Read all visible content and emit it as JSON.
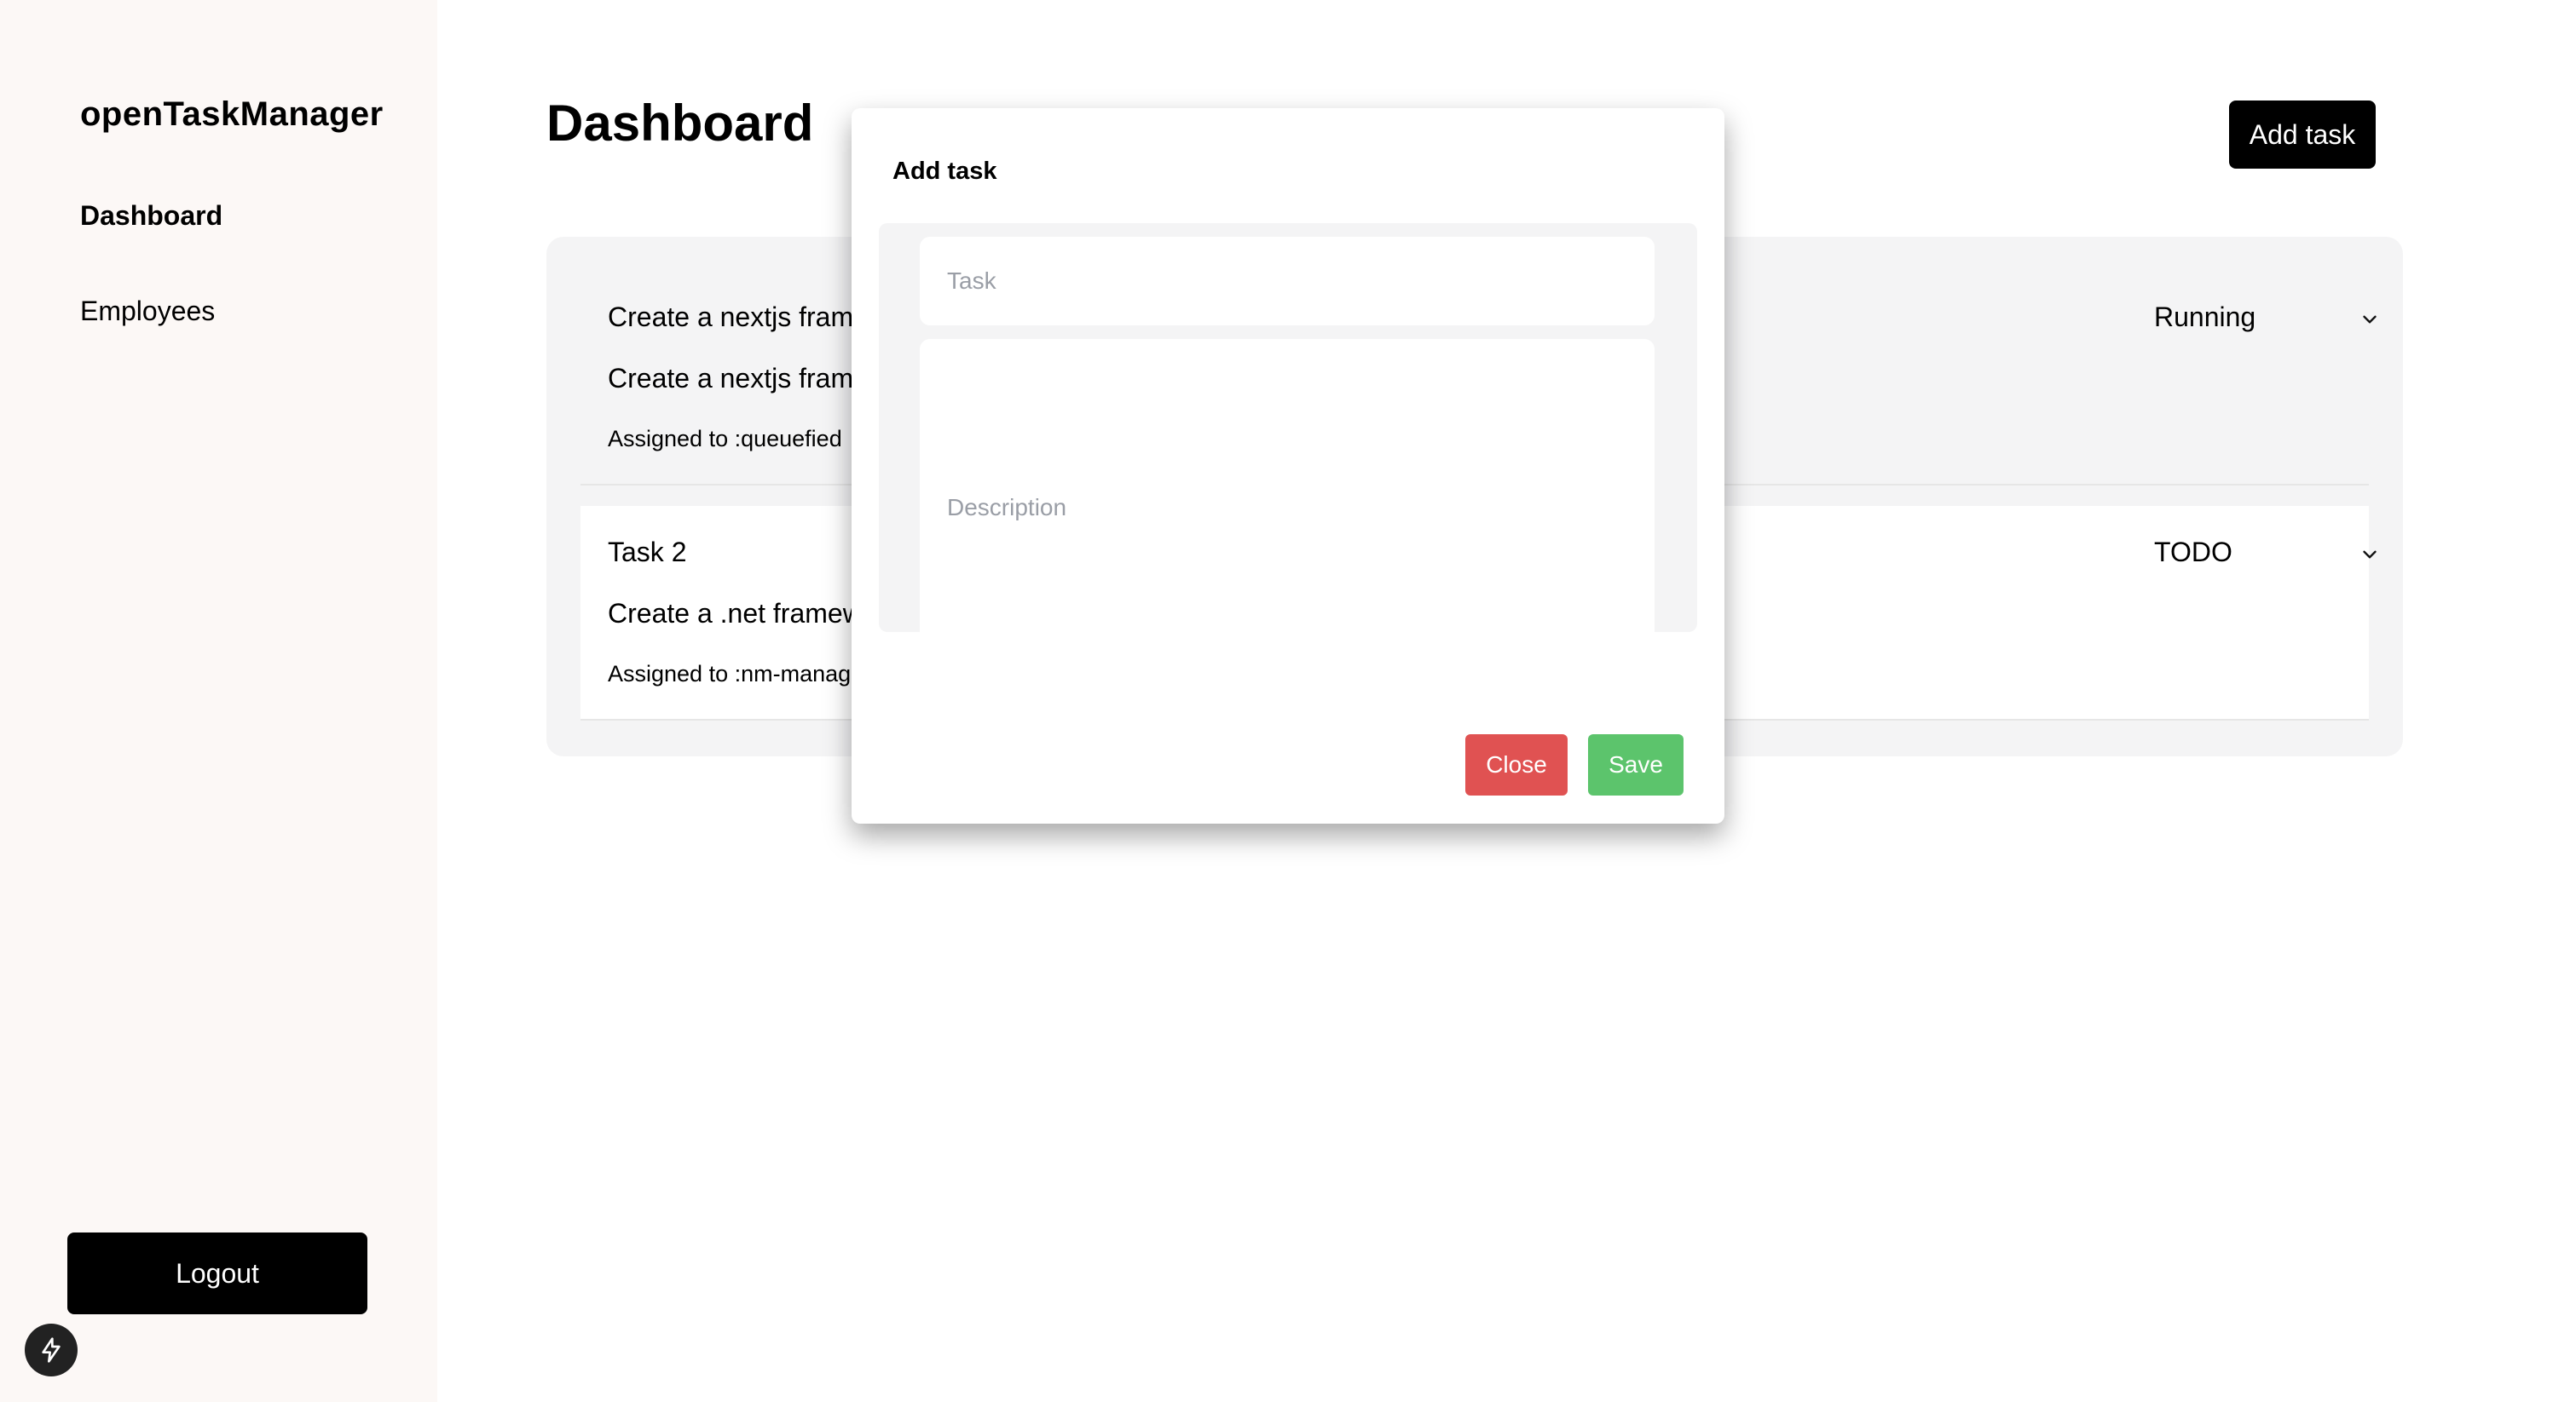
{
  "sidebar": {
    "brand": "openTaskManager",
    "items": [
      {
        "label": "Dashboard"
      },
      {
        "label": "Employees"
      }
    ],
    "logout_label": "Logout"
  },
  "main": {
    "title": "Dashboard",
    "add_task_label": "Add task",
    "tasks": [
      {
        "title": "Create a nextjs fram",
        "description": "Create a nextjs fram",
        "assigned": "Assigned to :queuefied",
        "status": "Running"
      },
      {
        "title": "Task 2",
        "description": "Create a .net framew",
        "assigned": "Assigned to :nm-manag",
        "status": "TODO"
      }
    ]
  },
  "modal": {
    "title": "Add task",
    "task_placeholder": "Task",
    "description_placeholder": "Description",
    "close_label": "Close",
    "save_label": "Save"
  },
  "colors": {
    "sidebar_bg": "#fcf8f6",
    "board_bg": "#f4f4f5",
    "close": "#e05252",
    "save": "#5cc46c"
  },
  "icons": {
    "status_dropdown": "chevron-down-icon",
    "dev_badge": "lightning-bolt-icon"
  }
}
